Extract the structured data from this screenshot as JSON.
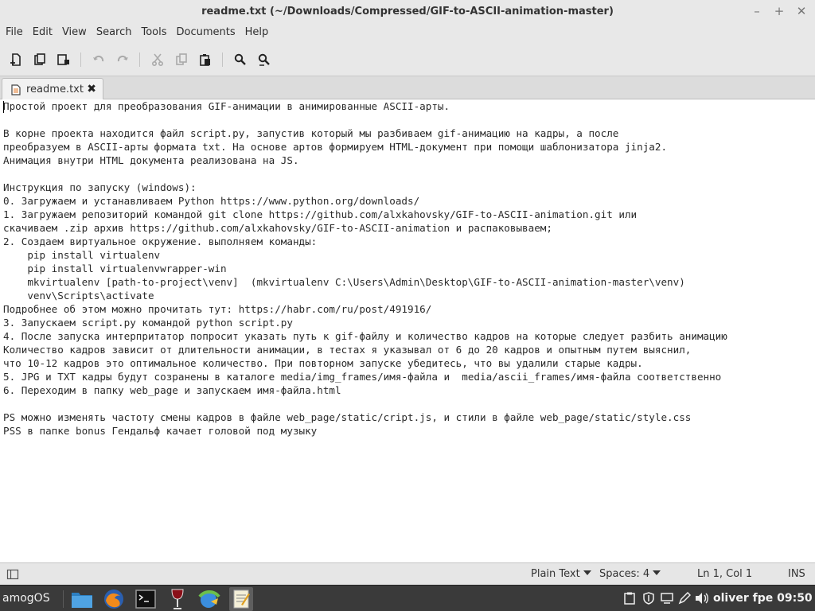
{
  "window": {
    "title": "readme.txt (~/Downloads/Compressed/GIF-to-ASCII-animation-master)"
  },
  "menu": [
    "File",
    "Edit",
    "View",
    "Search",
    "Tools",
    "Documents",
    "Help"
  ],
  "toolbar": {
    "icons": [
      "new-document-icon",
      "open-document-icon",
      "save-document-icon",
      "undo-icon",
      "redo-icon",
      "cut-icon",
      "copy-icon",
      "paste-icon",
      "search-icon",
      "search-replace-icon"
    ]
  },
  "tab": {
    "label": "readme.txt",
    "close": "✖"
  },
  "editor": {
    "lines": [
      "Простой проект для преобразования GIF-анимации в анимированные ASCII-арты.",
      "",
      "В корне проекта находится файл script.py, запустив который мы разбиваем gif-анимацию на кадры, а после",
      "преобразуем в ASCII-арты формата txt. На основе артов формируем HTML-документ при помощи шаблонизатора jinja2.",
      "Анимация внутри HTML документа реализована на JS.",
      "",
      "Инструкция по запуску (windows):",
      "0. Загружаем и устанавливаем Python https://www.python.org/downloads/",
      "1. Загружаем репозиторий командой git clone https://github.com/alxkahovsky/GIF-to-ASCII-animation.git или",
      "скачиваем .zip архив https://github.com/alxkahovsky/GIF-to-ASCII-animation и распаковываем;",
      "2. Создаем виртуальное окружение. выполняем команды:",
      "    pip install virtualenv",
      "    pip install virtualenvwrapper-win",
      "    mkvirtualenv [path-to-project\\venv]  (mkvirtualenv C:\\Users\\Admin\\Desktop\\GIF-to-ASCII-animation-master\\venv)",
      "    venv\\Scripts\\activate",
      "Подробнее об этом можно прочитать тут: https://habr.com/ru/post/491916/",
      "3. Запускаем script.py командой python script.py",
      "4. После запуска интерпритатор попросит указать путь к gif-файлу и количество кадров на которые следует разбить анимацию",
      "Количество кадров зависит от длительности анимации, в тестах я указывал от 6 до 20 кадров и опытным путем выяснил,",
      "что 10-12 кадров это оптимальное количество. При повторном запуске убедитесь, что вы удалили старые кадры.",
      "5. JPG и TXT кадры будут созранены в каталоге media/img_frames/имя-файла и  media/ascii_frames/имя-файла соответственно",
      "6. Переходим в папку web_page и запускаем имя-файла.html",
      "",
      "PS можно изменять частоту смены кадров в файле web_page/static/cript.js, и стили в файле web_page/static/style.css",
      "PSS в папке bonus Гендальф качает головой под музыку"
    ]
  },
  "statusbar": {
    "language": "Plain Text",
    "spaces": "Spaces: 4",
    "position": "Ln 1, Col 1",
    "mode": "INS"
  },
  "taskbar": {
    "start_label": "amogOS",
    "launchers": [
      "folder-icon",
      "firefox-icon",
      "terminal-icon",
      "wine-icon",
      "network-icon",
      "text-editor-icon"
    ],
    "tray": [
      "clipboard-icon",
      "shield-icon",
      "display-icon",
      "pen-icon",
      "volume-icon"
    ],
    "user": "oliver",
    "locale": "fpe",
    "time": "09:50"
  },
  "colors": {
    "chrome": "#e8e8e8",
    "taskbar": "#3a3a3a",
    "editor_bg": "#ffffff"
  }
}
